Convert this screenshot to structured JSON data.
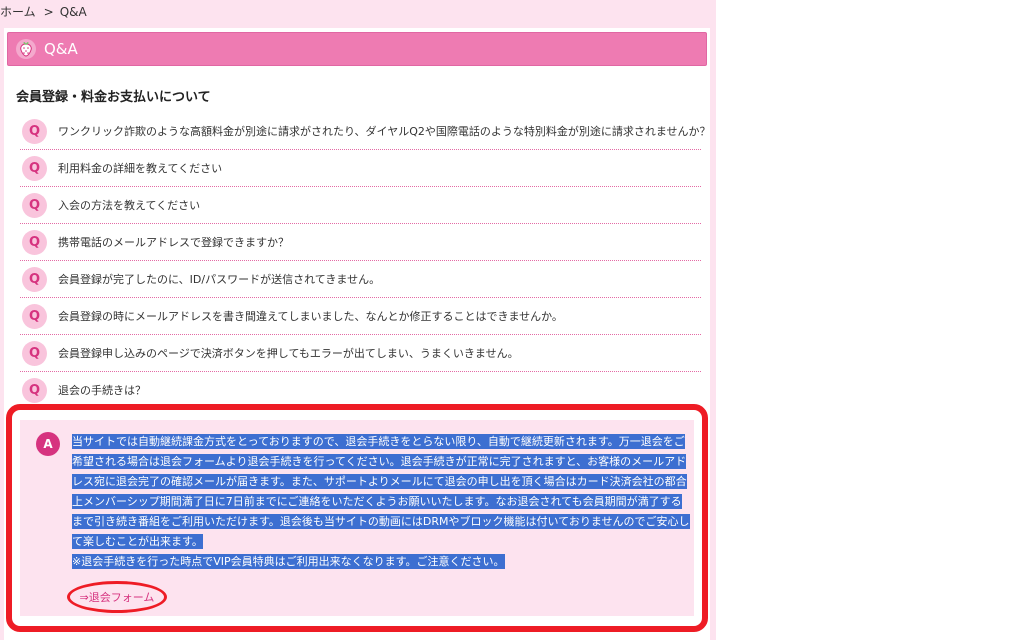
{
  "breadcrumb": {
    "home": "ホーム",
    "separator": ">",
    "current": "Q&A"
  },
  "header": {
    "title": "Q&A",
    "icon": "strawberry-icon",
    "color": "#ee7bb2"
  },
  "section": {
    "title": "会員登録・料金お支払いについて"
  },
  "faq": {
    "q_label": "Q",
    "items": [
      "ワンクリック詐欺のような高額料金が別途に請求がされたり、ダイヤルQ2や国際電話のような特別料金が別途に請求されませんか？",
      "利用料金の詳細を教えてください",
      "入会の方法を教えてください",
      "携帯電話のメールアドレスで登録できますか？",
      "会員登録が完了したのに、ID/パスワードが送信されてきません。",
      "会員登録の時にメールアドレスを書き間違えてしまいました、なんとか修正することはできませんか。",
      "会員登録申し込みのページで決済ボタンを押してもエラーが出てしまい、うまくいきません。",
      "退会の手続きは？"
    ]
  },
  "answer": {
    "a_label": "A",
    "body": "当サイトでは自動継続課金方式をとっておりますので、退会手続きをとらない限り、自動で継続更新されます。万一退会をご希望される場合は退会フォームより退会手続きを行ってください。退会手続きが正常に完了されますと、お客様のメールアドレス宛に退会完了の確認メールが届きます。また、サポートよりメールにて退会の申し出を頂く場合はカード決済会社の都合上メンバーシップ期間満了日に7日前までにご連絡をいただくようお願いいたします。なお退会されても会員期間が満了するまで引き続き番組をご利用いただけます。退会後も当サイトの動画にはDRMやブロック機能は付いておりませんのでご安心して楽しむことが出来ます。",
    "note": "※退会手続きを行った時点でVIP会員特典はご利用出来なくなります。ご注意ください。",
    "link_label": "⇒退会フォーム"
  },
  "colors": {
    "accent_pink": "#ee7bb2",
    "highlight_blue": "#3d6fd1",
    "annotation_red": "#ee1c25",
    "page_bg": "#fde3ef"
  }
}
